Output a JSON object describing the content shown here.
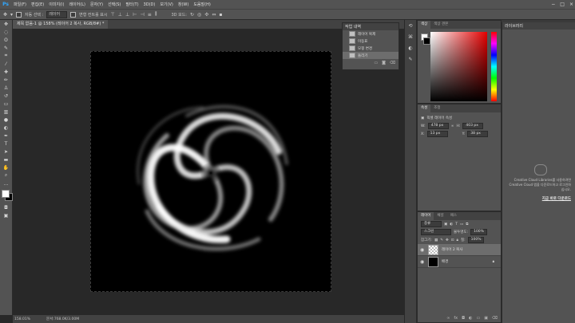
{
  "menubar": {
    "app_icon": "Ps",
    "items": [
      "파일(F)",
      "편집(E)",
      "이미지(I)",
      "레이어(L)",
      "문자(Y)",
      "선택(S)",
      "필터(T)",
      "3D(D)",
      "보기(V)",
      "창(W)",
      "도움말(H)"
    ],
    "controls": [
      "−",
      "□",
      "×"
    ]
  },
  "options_bar": {
    "auto_select_label": "자동 선택 :",
    "auto_select_value": "레이어",
    "show_transform_label": "변형 컨트롤 표시",
    "mode_3d": "3D 모드:"
  },
  "document": {
    "tab_title": "제목 없음-1 @ 158% (레이어 2 복사, RGB/8#) *",
    "zoom": "158.01%",
    "doc_info": "문서:768.0K/3.00M"
  },
  "history_panel": {
    "title": "작업 내역",
    "items": [
      "레이어 복제",
      "이동표",
      "모핑 변경",
      "돌리기"
    ],
    "active_index": 3
  },
  "color_panel": {
    "tabs": [
      "색상",
      "색상 견본"
    ]
  },
  "properties_panel": {
    "tabs": [
      "속성",
      "조정"
    ],
    "subtitle": "픽셀 레이어 속성",
    "w_label": "W:",
    "w_value": "478 px",
    "h_label": "H:",
    "h_value": "403 px",
    "x_label": "X:",
    "x_value": "13 px",
    "y_label": "Y:",
    "y_value": "38 px"
  },
  "layers_panel": {
    "tabs": [
      "레이어",
      "채널",
      "패스"
    ],
    "filter_label": "종류",
    "blend_mode": "스크린",
    "opacity_label": "불투명도:",
    "opacity_value": "100%",
    "lock_label": "잠그기:",
    "fill_label": "칠:",
    "fill_value": "100%",
    "layers": [
      {
        "name": "레이어 2 복사",
        "selected": true
      },
      {
        "name": "배경",
        "selected": false
      }
    ]
  },
  "libraries_panel": {
    "title": "라이브러리",
    "message": "Creative Cloud Libraries를 사용하려면 Creative Cloud 앱을 다운로드하고 로그인하십시오.",
    "link": "지금 바로 다운로드"
  },
  "colors": {
    "accent": "#31a8ff",
    "panel": "#535353",
    "dark": "#282828"
  }
}
